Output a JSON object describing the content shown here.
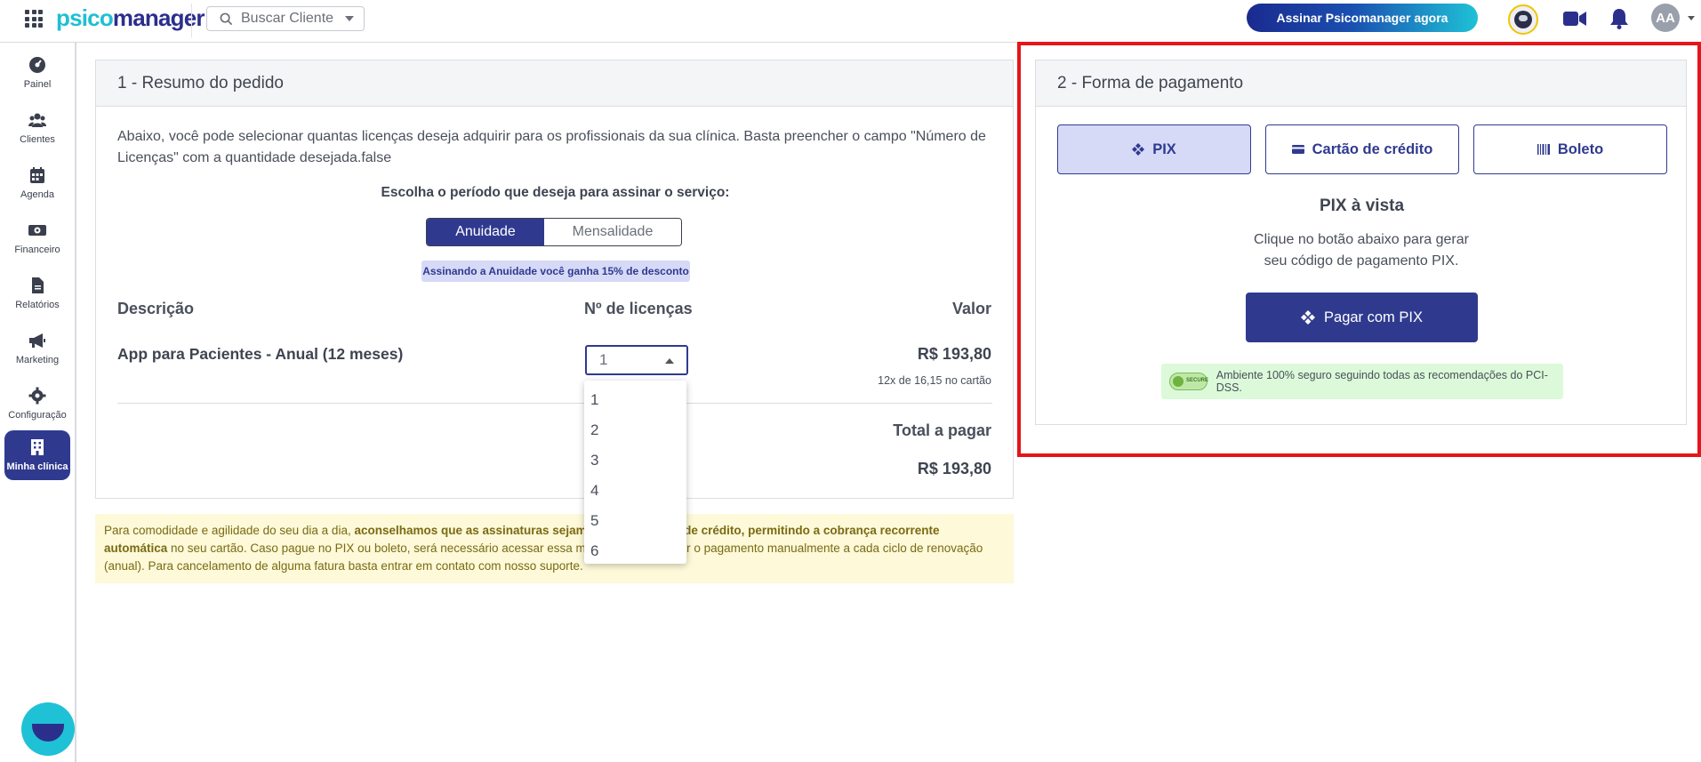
{
  "brand": {
    "logo_part1": "psico",
    "logo_part2": "manager"
  },
  "header": {
    "search_placeholder": "Buscar Cliente",
    "subscribe_label": "Assinar Psicomanager agora",
    "avatar_initials": "AA"
  },
  "sidebar": {
    "items": [
      {
        "label": "Painel",
        "icon": "dashboard-icon"
      },
      {
        "label": "Clientes",
        "icon": "users-icon"
      },
      {
        "label": "Agenda",
        "icon": "calendar-icon"
      },
      {
        "label": "Financeiro",
        "icon": "money-icon"
      },
      {
        "label": "Relatórios",
        "icon": "report-icon"
      },
      {
        "label": "Marketing",
        "icon": "megaphone-icon"
      },
      {
        "label": "Configuração",
        "icon": "gear-icon"
      },
      {
        "label": "Minha clínica",
        "icon": "building-icon",
        "active": true
      }
    ]
  },
  "order": {
    "title": "1 - Resumo do pedido",
    "intro": "Abaixo, você pode selecionar quantas licenças deseja adquirir para os profissionais da sua clínica. Basta preencher o campo \"Número de Licenças\" com a quantidade desejada.false",
    "period_title": "Escolha o período que deseja para assinar o serviço:",
    "period_options": [
      "Anuidade",
      "Mensalidade"
    ],
    "discount_badge": "Assinando a Anuidade você ganha 15% de desconto",
    "columns": {
      "description": "Descrição",
      "licenses": "Nº de licenças",
      "value": "Valor"
    },
    "product": {
      "name": "App para Pacientes - Anual (12 meses)",
      "licenses_selected": "1",
      "price": "R$ 193,80",
      "installments": "12x de 16,15 no cartão"
    },
    "license_options": [
      "1",
      "2",
      "3",
      "4",
      "5",
      "6"
    ],
    "total_label": "Total a pagar",
    "total_value": "R$ 193,80"
  },
  "notice": {
    "part1": "Para comodidade e agilidade do seu dia a dia, ",
    "bold": "aconselhamos que as assinaturas sejam feitas via cartão de crédito, permitindo a cobrança recorrente automática",
    "part2": " no seu cartão. Caso pague no PIX ou boleto, será necessário acessar essa mesma tela e realizar o pagamento manualmente a cada ciclo de renovação (anual). Para cancelamento de alguma fatura basta entrar em contato com nosso suporte."
  },
  "payment": {
    "title": "2 - Forma de pagamento",
    "methods": [
      "PIX",
      "Cartão de crédito",
      "Boleto"
    ],
    "active_method": "PIX",
    "pix_title": "PIX à vista",
    "pix_desc_line1": "Clique no botão abaixo para gerar",
    "pix_desc_line2": "seu código de pagamento PIX.",
    "pix_button": "Pagar com PIX",
    "secure_text": "Ambiente 100% seguro seguindo todas as recomendações do PCI-DSS."
  },
  "colors": {
    "primary": "#2f3a8f",
    "accent": "#1fc1d6",
    "highlight": "#e3161b",
    "notice_bg": "#fdf9d9"
  }
}
